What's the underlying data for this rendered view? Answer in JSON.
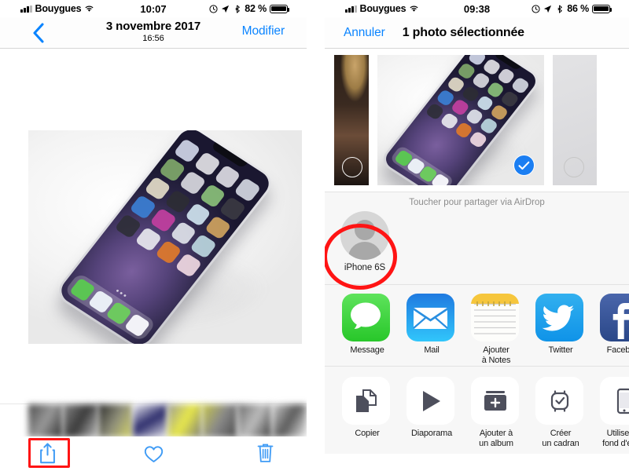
{
  "left_panel": {
    "status_bar": {
      "carrier": "Bouygues",
      "time": "10:07",
      "battery_text": "82 %",
      "icons": [
        "signal-icon",
        "wifi-icon",
        "alarm-icon",
        "location-icon",
        "bluetooth-icon",
        "battery-icon"
      ]
    },
    "nav": {
      "back_label": "chevron-left-icon",
      "date": "3 novembre 2017",
      "time": "16:56",
      "edit_label": "Modifier"
    },
    "photo": {
      "description": "Photo d'un iPhone X posé sur une surface blanche"
    },
    "toolbar": {
      "share_label": "share-icon",
      "favorite_label": "heart-icon",
      "delete_label": "trash-icon"
    },
    "annotation": {
      "color": "#ff1414",
      "target": "share-button"
    }
  },
  "right_panel": {
    "status_bar": {
      "carrier": "Bouygues",
      "time": "09:38",
      "battery_text": "86 %",
      "icons": [
        "signal-icon",
        "wifi-icon",
        "alarm-icon",
        "location-icon",
        "bluetooth-icon",
        "battery-icon"
      ]
    },
    "nav": {
      "cancel_label": "Annuler",
      "title": "1 photo sélectionnée"
    },
    "picker": {
      "items": [
        {
          "name": "photo-previous",
          "selected": false
        },
        {
          "name": "photo-current",
          "selected": true
        },
        {
          "name": "photo-next",
          "selected": false
        }
      ]
    },
    "airdrop": {
      "hint": "Toucher pour partager via AirDrop",
      "contacts": [
        {
          "name": "iPhone 6S"
        }
      ],
      "annotation": {
        "color": "#ff1414",
        "target": "airdrop-contact-iphone-6s"
      }
    },
    "share_targets": [
      {
        "label": "Message",
        "icon": "messages-icon",
        "color": "#3ed551"
      },
      {
        "label": "Mail",
        "icon": "mail-icon",
        "color": "#1e9cf5"
      },
      {
        "label": "Ajouter\nà Notes",
        "icon": "notes-icon",
        "color": "#f7ca3c"
      },
      {
        "label": "Twitter",
        "icon": "twitter-icon",
        "color": "#1da1f2"
      },
      {
        "label": "Facebook",
        "icon": "facebook-icon",
        "color": "#3b5998"
      }
    ],
    "actions": [
      {
        "label": "Copier",
        "icon": "copy-icon"
      },
      {
        "label": "Diaporama",
        "icon": "play-icon"
      },
      {
        "label": "Ajouter à\nun album",
        "icon": "add-to-album-icon"
      },
      {
        "label": "Créer\nun cadran",
        "icon": "watch-face-icon"
      },
      {
        "label": "Utiliser en\nfond d'écran",
        "icon": "wallpaper-icon"
      }
    ]
  },
  "colors": {
    "ios_blue": "#0a84ff",
    "annotation_red": "#ff1414",
    "sheet_bg": "#f7f7f7"
  }
}
